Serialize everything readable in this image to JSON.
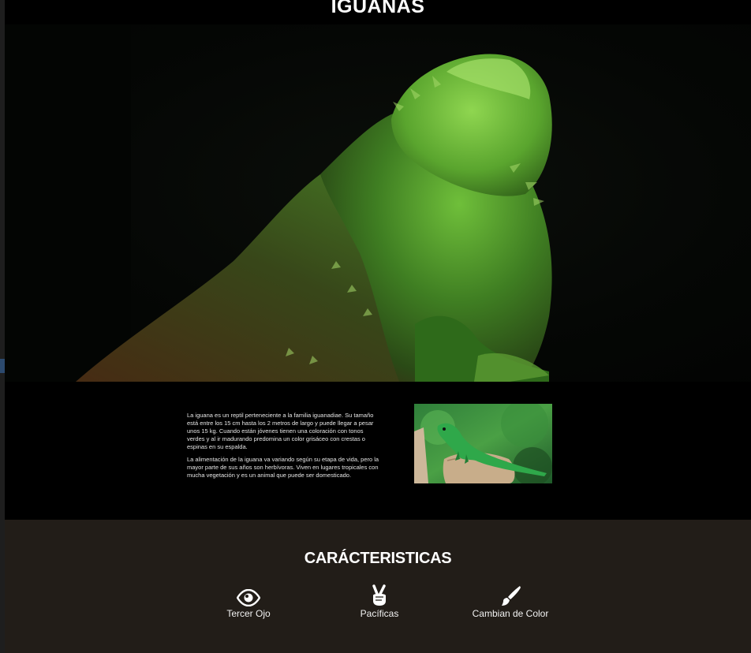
{
  "header": {
    "title": "IGUANAS"
  },
  "intro": {
    "paragraph_1": "La iguana es un reptil perteneciente a la familia iguanadiae. Su tamaño está entre los 15 cm hasta los 2 metros de largo y puede llegar a pesar unos 15 kg. Cuando están jóvenes tienen una coloración con tonos verdes y al ir madurando predomina un color grisáceo con crestas o espinas en su espalda.",
    "paragraph_2": "La alimentación de la iguana va variando según su etapa de vida, pero la mayor parte de sus años son herbívoras. Viven en lugares tropicales con mucha vegetación y es un animal que puede ser domesticado."
  },
  "features": {
    "title": "CARÁCTERISTICAS",
    "items": [
      {
        "label": "Tercer Ojo",
        "icon": "eye-icon"
      },
      {
        "label": "Pacíficas",
        "icon": "peace-hand-icon"
      },
      {
        "label": "Cambian de Color",
        "icon": "paintbrush-icon"
      }
    ]
  },
  "colors": {
    "page_background": "#000000",
    "features_background": "#221d18",
    "text": "#ffffff"
  }
}
